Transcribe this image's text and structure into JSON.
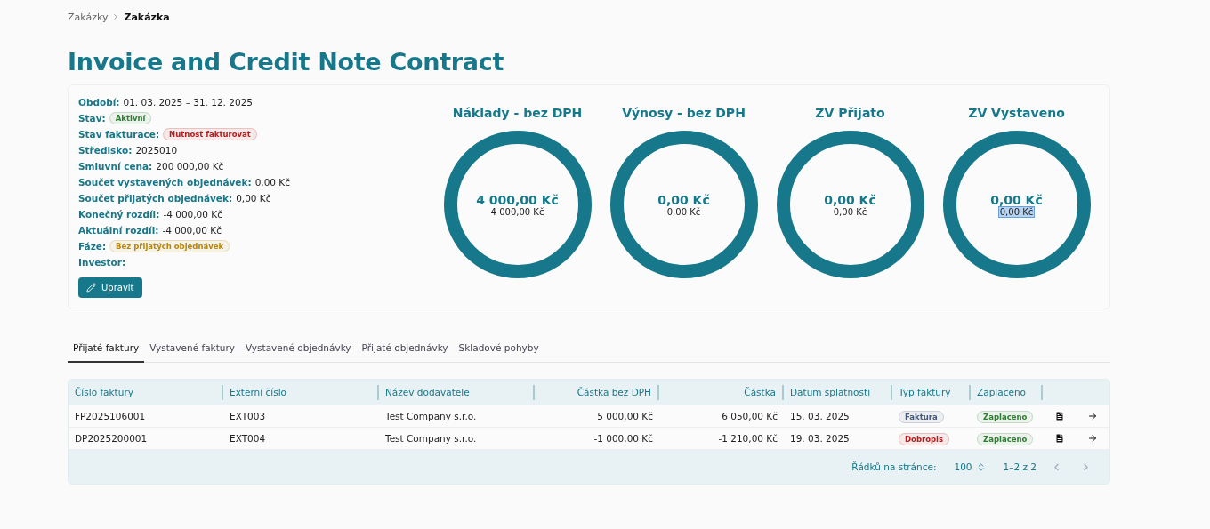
{
  "breadcrumb": [
    {
      "label": "Zakázky",
      "current": false
    },
    {
      "label": "Zakázka",
      "current": true
    }
  ],
  "title": "Invoice and Credit Note Contract",
  "info": [
    {
      "kind": "text",
      "label": "Období:",
      "value": "01. 03. 2025 – 31. 12. 2025"
    },
    {
      "kind": "badge",
      "label": "Stav:",
      "value": "Aktivní",
      "color": "#2e7d32"
    },
    {
      "kind": "badge",
      "label": "Stav fakturace:",
      "value": "Nutnost fakturovat",
      "color": "#b71c1c"
    },
    {
      "kind": "text",
      "label": "Středisko:",
      "value": "2025010"
    },
    {
      "kind": "text",
      "label": "Smluvní cena:",
      "value": "200 000,00 Kč"
    },
    {
      "kind": "text",
      "label": "Součet vystavených objednávek:",
      "value": "0,00 Kč"
    },
    {
      "kind": "text",
      "label": "Součet přijatých objednávek:",
      "value": "0,00 Kč"
    },
    {
      "kind": "text",
      "label": "Konečný rozdíl:",
      "value": "-4 000,00 Kč"
    },
    {
      "kind": "text",
      "label": "Aktuální rozdíl:",
      "value": "-4 000,00 Kč"
    },
    {
      "kind": "badge",
      "label": "Fáze:",
      "value": "Bez přijatých objednávek",
      "color": "#b8860b"
    },
    {
      "kind": "text",
      "label": "Investor:"
    }
  ],
  "edit_button": "Upravit",
  "summaries": [
    {
      "title": "Náklady - bez DPH",
      "value": "4 000,00 Kč",
      "subvalue": "4 000,00 Kč",
      "highlighted": false
    },
    {
      "title": "Výnosy - bez DPH",
      "value": "0,00 Kč",
      "subvalue": "0,00 Kč",
      "highlighted": false
    },
    {
      "title": "ZV Přijato",
      "value": "0,00 Kč",
      "subvalue": "0,00 Kč",
      "highlighted": false
    },
    {
      "title": "ZV Vystaveno",
      "value": "0,00 Kč",
      "subvalue": "0,00 Kč",
      "highlighted": true
    }
  ],
  "tabs": [
    {
      "label": "Přijaté faktury",
      "selected": true
    },
    {
      "label": "Vystavené faktury",
      "selected": false
    },
    {
      "label": "Vystavené objednávky",
      "selected": false
    },
    {
      "label": "Přijaté objednávky",
      "selected": false
    },
    {
      "label": "Skladové pohyby",
      "selected": false
    }
  ],
  "table": {
    "columns": [
      "Číslo faktury",
      "Externí číslo",
      "Název dodavatele",
      "Částka bez DPH",
      "Částka",
      "Datum splatnosti",
      "Typ faktury",
      "Zaplaceno"
    ],
    "rows": [
      {
        "number": "FP2025106001",
        "external": "EXT003",
        "supplier": "Test Company s.r.o.",
        "net": "5 000,00 Kč",
        "gross": "6 050,00 Kč",
        "due": "15. 03. 2025",
        "type": {
          "label": "Faktura",
          "color": "#455a7a"
        },
        "paid": "Zaplaceno"
      },
      {
        "number": "DP2025200001",
        "external": "EXT004",
        "supplier": "Test Company s.r.o.",
        "net": "-1 000,00 Kč",
        "gross": "-1 210,00 Kč",
        "due": "19. 03. 2025",
        "type": {
          "label": "Dobropis",
          "color": "#b71c1c"
        },
        "paid": "Zaplaceno"
      }
    ]
  },
  "pagination": {
    "rows_label": "Řádků na stránce:",
    "rows_value": "100",
    "range": "1–2 z 2"
  }
}
